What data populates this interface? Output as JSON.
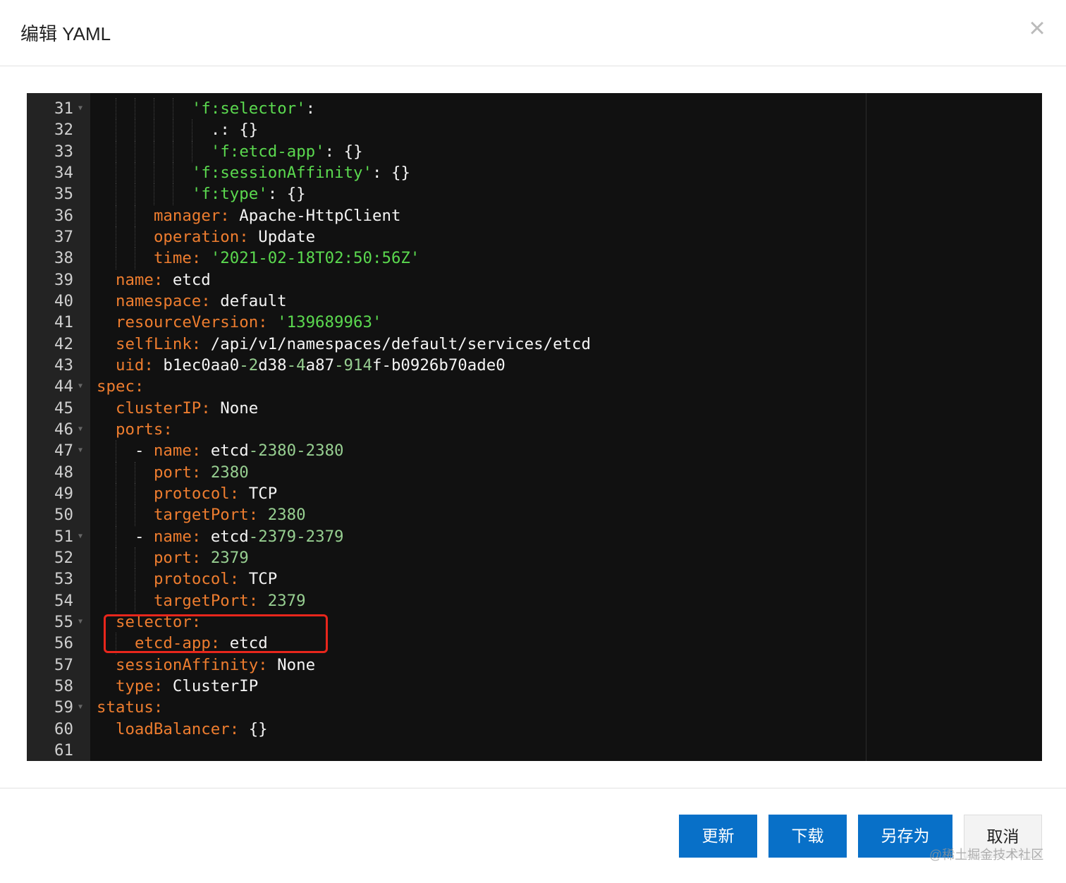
{
  "dialog": {
    "title": "编辑 YAML",
    "close_icon": "close-icon"
  },
  "editor": {
    "colors": {
      "key": "#ee7d2f",
      "string": "#5bd94f",
      "number": "#97cf91",
      "text": "#f4f4f4",
      "background": "#111111",
      "gutter": "#232323"
    },
    "lines": [
      {
        "n": "31",
        "fold": true,
        "indent": 10,
        "seg": [
          [
            "'f:selector'",
            "s"
          ],
          [
            ":",
            "t"
          ]
        ]
      },
      {
        "n": "32",
        "fold": false,
        "indent": 12,
        "seg": [
          [
            ".: {}",
            "t"
          ]
        ]
      },
      {
        "n": "33",
        "fold": false,
        "indent": 12,
        "seg": [
          [
            "'f:etcd-app'",
            "s"
          ],
          [
            ": {}",
            "t"
          ]
        ]
      },
      {
        "n": "34",
        "fold": false,
        "indent": 10,
        "seg": [
          [
            "'f:sessionAffinity'",
            "s"
          ],
          [
            ": {}",
            "t"
          ]
        ]
      },
      {
        "n": "35",
        "fold": false,
        "indent": 10,
        "seg": [
          [
            "'f:type'",
            "s"
          ],
          [
            ": {}",
            "t"
          ]
        ]
      },
      {
        "n": "36",
        "fold": false,
        "indent": 6,
        "seg": [
          [
            "manager: ",
            "k"
          ],
          [
            "Apache-HttpClient",
            "t"
          ]
        ]
      },
      {
        "n": "37",
        "fold": false,
        "indent": 6,
        "seg": [
          [
            "operation: ",
            "k"
          ],
          [
            "Update",
            "t"
          ]
        ]
      },
      {
        "n": "38",
        "fold": false,
        "indent": 6,
        "seg": [
          [
            "time: ",
            "k"
          ],
          [
            "'2021-02-18T02:50:56Z'",
            "s"
          ]
        ]
      },
      {
        "n": "39",
        "fold": false,
        "indent": 2,
        "seg": [
          [
            "name: ",
            "k"
          ],
          [
            "etcd",
            "t"
          ]
        ]
      },
      {
        "n": "40",
        "fold": false,
        "indent": 2,
        "seg": [
          [
            "namespace: ",
            "k"
          ],
          [
            "default",
            "t"
          ]
        ]
      },
      {
        "n": "41",
        "fold": false,
        "indent": 2,
        "seg": [
          [
            "resourceVersion: ",
            "k"
          ],
          [
            "'139689963'",
            "s"
          ]
        ]
      },
      {
        "n": "42",
        "fold": false,
        "indent": 2,
        "seg": [
          [
            "selfLink: ",
            "k"
          ],
          [
            "/api/v1/namespaces/default/services/etcd",
            "t"
          ]
        ]
      },
      {
        "n": "43",
        "fold": false,
        "indent": 2,
        "seg": [
          [
            "uid: ",
            "k"
          ],
          [
            "b1ec0aa0",
            "t"
          ],
          [
            "-2",
            "n"
          ],
          [
            "d38",
            "t"
          ],
          [
            "-4",
            "n"
          ],
          [
            "a87",
            "t"
          ],
          [
            "-914",
            "n"
          ],
          [
            "f-b0926b70ade0",
            "t"
          ]
        ]
      },
      {
        "n": "44",
        "fold": true,
        "indent": 0,
        "seg": [
          [
            "spec:",
            "k"
          ]
        ]
      },
      {
        "n": "45",
        "fold": false,
        "indent": 2,
        "seg": [
          [
            "clusterIP: ",
            "k"
          ],
          [
            "None",
            "t"
          ]
        ]
      },
      {
        "n": "46",
        "fold": true,
        "indent": 2,
        "seg": [
          [
            "ports:",
            "k"
          ]
        ]
      },
      {
        "n": "47",
        "fold": true,
        "indent": 4,
        "seg": [
          [
            "- ",
            "t"
          ],
          [
            "name: ",
            "k"
          ],
          [
            "etcd",
            "t"
          ],
          [
            "-2380-2380",
            "n"
          ]
        ]
      },
      {
        "n": "48",
        "fold": false,
        "indent": 6,
        "seg": [
          [
            "port: ",
            "k"
          ],
          [
            "2380",
            "n"
          ]
        ]
      },
      {
        "n": "49",
        "fold": false,
        "indent": 6,
        "seg": [
          [
            "protocol: ",
            "k"
          ],
          [
            "TCP",
            "t"
          ]
        ]
      },
      {
        "n": "50",
        "fold": false,
        "indent": 6,
        "seg": [
          [
            "targetPort: ",
            "k"
          ],
          [
            "2380",
            "n"
          ]
        ]
      },
      {
        "n": "51",
        "fold": true,
        "indent": 4,
        "seg": [
          [
            "- ",
            "t"
          ],
          [
            "name: ",
            "k"
          ],
          [
            "etcd",
            "t"
          ],
          [
            "-2379-2379",
            "n"
          ]
        ]
      },
      {
        "n": "52",
        "fold": false,
        "indent": 6,
        "seg": [
          [
            "port: ",
            "k"
          ],
          [
            "2379",
            "n"
          ]
        ]
      },
      {
        "n": "53",
        "fold": false,
        "indent": 6,
        "seg": [
          [
            "protocol: ",
            "k"
          ],
          [
            "TCP",
            "t"
          ]
        ]
      },
      {
        "n": "54",
        "fold": false,
        "indent": 6,
        "seg": [
          [
            "targetPort: ",
            "k"
          ],
          [
            "2379",
            "n"
          ]
        ]
      },
      {
        "n": "55",
        "fold": true,
        "indent": 2,
        "seg": [
          [
            "selector:",
            "k"
          ]
        ]
      },
      {
        "n": "56",
        "fold": false,
        "indent": 4,
        "seg": [
          [
            "etcd-app: ",
            "k"
          ],
          [
            "etcd",
            "t"
          ]
        ]
      },
      {
        "n": "57",
        "fold": false,
        "indent": 2,
        "seg": [
          [
            "sessionAffinity: ",
            "k"
          ],
          [
            "None",
            "t"
          ]
        ]
      },
      {
        "n": "58",
        "fold": false,
        "indent": 2,
        "seg": [
          [
            "type: ",
            "k"
          ],
          [
            "ClusterIP",
            "t"
          ]
        ]
      },
      {
        "n": "59",
        "fold": true,
        "indent": 0,
        "seg": [
          [
            "status:",
            "k"
          ]
        ]
      },
      {
        "n": "60",
        "fold": false,
        "indent": 2,
        "seg": [
          [
            "loadBalancer: ",
            "k"
          ],
          [
            "{}",
            "t"
          ]
        ]
      },
      {
        "n": "61",
        "fold": false,
        "indent": 0,
        "seg": []
      }
    ]
  },
  "highlight_color": "#e8261c",
  "footer": {
    "update": "更新",
    "download": "下载",
    "save_as": "另存为",
    "cancel": "取消",
    "primary_color": "#0870c8"
  },
  "watermark": "@稀土掘金技术社区"
}
